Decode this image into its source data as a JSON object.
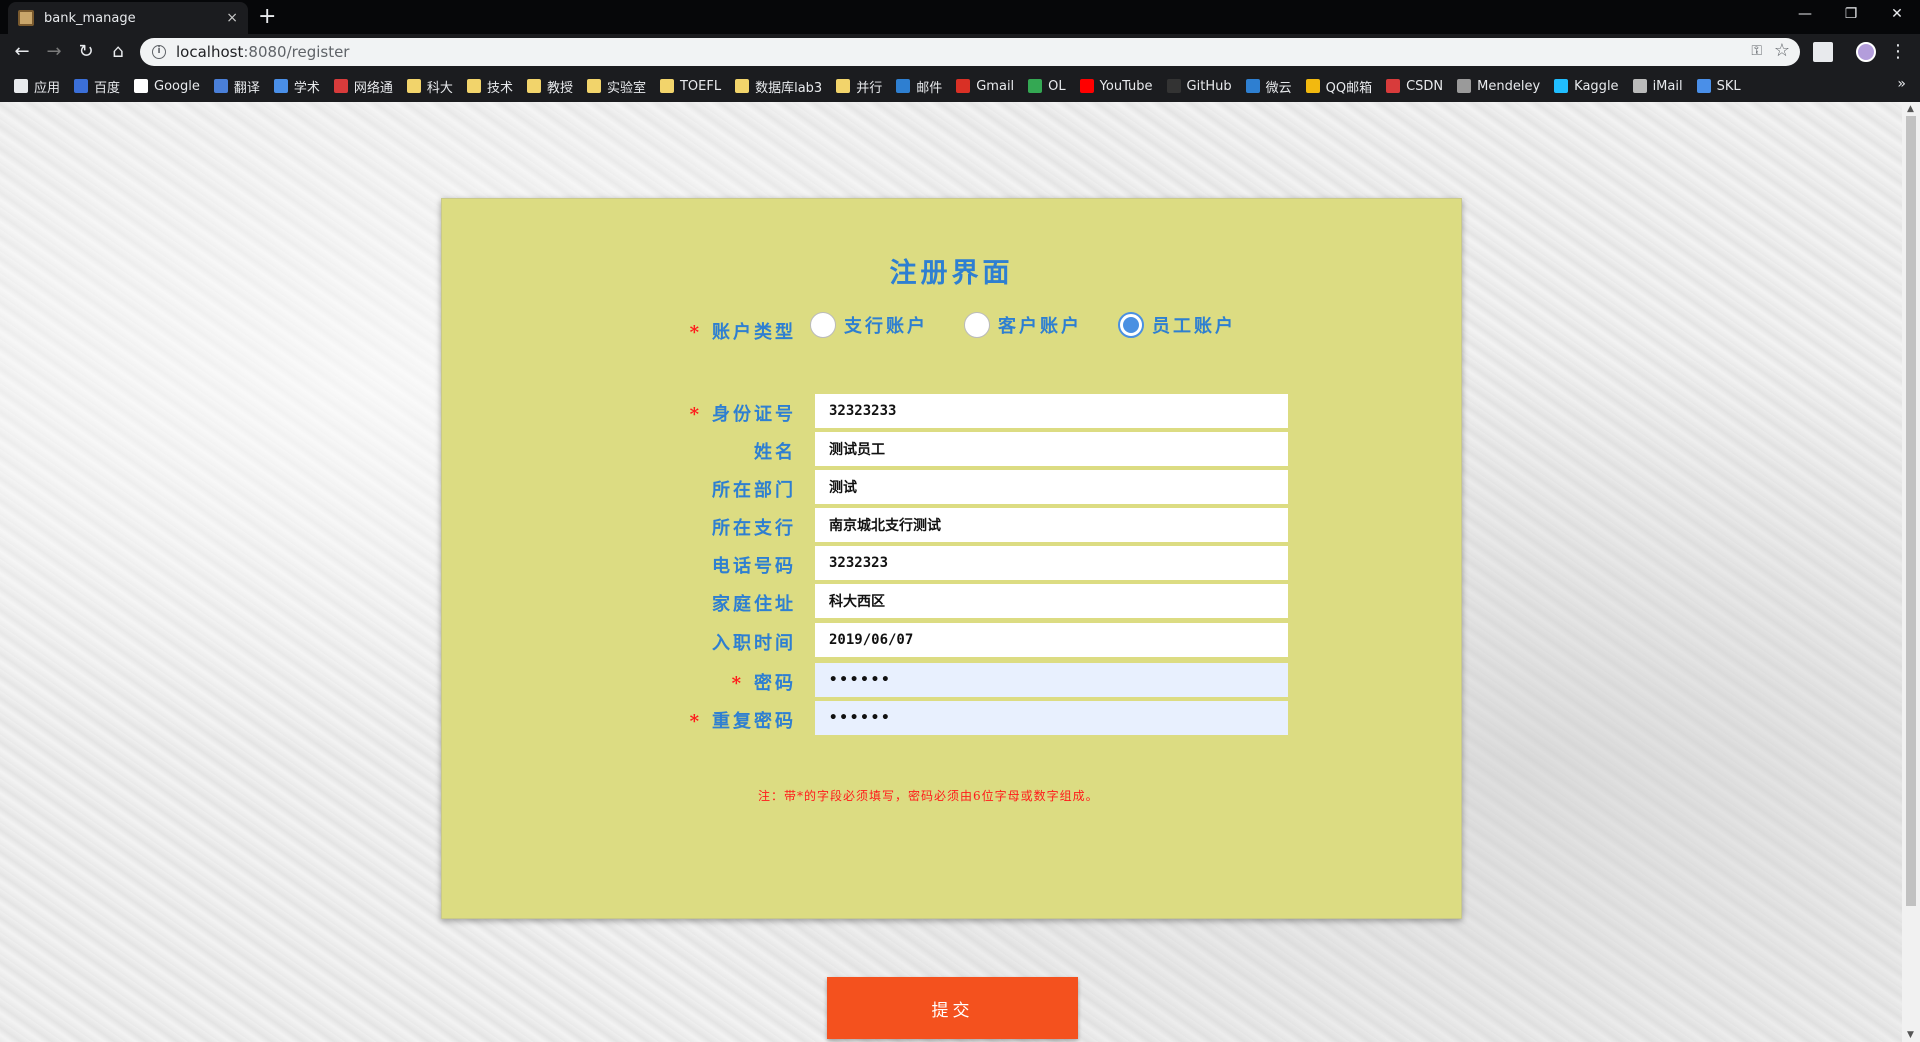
{
  "browser": {
    "tab_title": "bank_manage",
    "tab_close": "×",
    "new_tab": "+",
    "url_host": "localhost",
    "url_path": ":8080/register",
    "window_controls": [
      "—",
      "❐",
      "✕"
    ],
    "bookmarks": [
      {
        "label": "应用",
        "icon": "apps-grid-icon",
        "color": "#e8eaed"
      },
      {
        "label": "百度",
        "icon": "baidu-icon",
        "color": "#3b6fd8"
      },
      {
        "label": "Google",
        "icon": "google-icon",
        "color": "#ffffff"
      },
      {
        "label": "翻译",
        "icon": "translate-icon",
        "color": "#4a7fd8"
      },
      {
        "label": "学术",
        "icon": "scholar-icon",
        "color": "#4a8fe8"
      },
      {
        "label": "网络通",
        "icon": "network-icon",
        "color": "#d83b3b"
      },
      {
        "label": "科大",
        "icon": "folder-icon",
        "color": "#f2d46b"
      },
      {
        "label": "技术",
        "icon": "folder-icon",
        "color": "#f2d46b"
      },
      {
        "label": "教授",
        "icon": "folder-icon",
        "color": "#f2d46b"
      },
      {
        "label": "实验室",
        "icon": "folder-icon",
        "color": "#f2d46b"
      },
      {
        "label": "TOEFL",
        "icon": "folder-icon",
        "color": "#f2d46b"
      },
      {
        "label": "数据库lab3",
        "icon": "folder-icon",
        "color": "#f2d46b"
      },
      {
        "label": "并行",
        "icon": "folder-icon",
        "color": "#f2d46b"
      },
      {
        "label": "邮件",
        "icon": "mail-c-icon",
        "color": "#2e7fd1"
      },
      {
        "label": "Gmail",
        "icon": "gmail-icon",
        "color": "#d93025"
      },
      {
        "label": "OL",
        "icon": "ol-icon",
        "color": "#34a853"
      },
      {
        "label": "YouTube",
        "icon": "youtube-icon",
        "color": "#ff0000"
      },
      {
        "label": "GitHub",
        "icon": "github-icon",
        "color": "#333333"
      },
      {
        "label": "微云",
        "icon": "weiyun-icon",
        "color": "#2e7fd1"
      },
      {
        "label": "QQ邮箱",
        "icon": "qqmail-icon",
        "color": "#f2b90f"
      },
      {
        "label": "CSDN",
        "icon": "csdn-icon",
        "color": "#d83b3b"
      },
      {
        "label": "Mendeley",
        "icon": "mendeley-icon",
        "color": "#9a9a9a"
      },
      {
        "label": "Kaggle",
        "icon": "kaggle-icon",
        "color": "#20beff"
      },
      {
        "label": "iMail",
        "icon": "apple-icon",
        "color": "#bbbbbb"
      },
      {
        "label": "SKL",
        "icon": "skl-icon",
        "color": "#4a8fe8"
      }
    ],
    "bookmarks_more": "»"
  },
  "form": {
    "title": "注册界面",
    "required_mark": "*",
    "account_type": {
      "label": "账户类型",
      "options": [
        "支行账户",
        "客户账户",
        "员工账户"
      ],
      "selected_index": 2
    },
    "fields": [
      {
        "key": "id_number",
        "label": "身份证号",
        "value": "32323233",
        "required": true
      },
      {
        "key": "name",
        "label": "姓名",
        "value": "测试员工",
        "required": false
      },
      {
        "key": "department",
        "label": "所在部门",
        "value": "测试",
        "required": false
      },
      {
        "key": "branch",
        "label": "所在支行",
        "value": "南京城北支行测试",
        "required": false
      },
      {
        "key": "phone",
        "label": "电话号码",
        "value": "3232323",
        "required": false
      },
      {
        "key": "address",
        "label": "家庭住址",
        "value": "科大西区",
        "required": false
      },
      {
        "key": "hire_date",
        "label": "入职时间",
        "value": "2019/06/07",
        "required": false
      },
      {
        "key": "password",
        "label": "密码",
        "value": "••••••",
        "required": true
      },
      {
        "key": "password_repeat",
        "label": "重复密码",
        "value": "••••••",
        "required": true
      }
    ],
    "note": "注：带*的字段必须填写，密码必须由6位字母或数字组成。",
    "submit_label": "提交"
  },
  "colors": {
    "card_bg": "#dcdc82",
    "label_blue": "#2e7fd1",
    "required_red": "#ff1a1a",
    "submit_orange": "#f4511e",
    "radio_blue": "#4a90e2"
  }
}
